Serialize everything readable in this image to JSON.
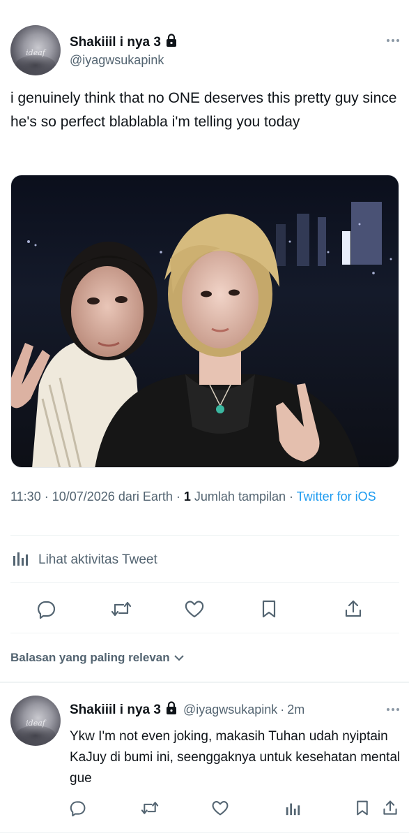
{
  "tweet": {
    "author": {
      "name": "Shakiiil i nya 3",
      "handle": "@iyagwsukapink",
      "avatar_text": "ideaf",
      "protected_icon": "lock-icon"
    },
    "text": "i genuinely think that no ONE deserves this pretty guy since he's so perfect blablabla i'm telling you today",
    "meta": {
      "time": "11:30",
      "date": "10/07/2026",
      "from_label": "dari",
      "location": "Earth",
      "view_count": "1",
      "view_label": "Jumlah tampilan",
      "client": "Twitter for iOS"
    },
    "activity_label": "Lihat aktivitas Tweet",
    "actions": [
      "reply-icon",
      "retweet-icon",
      "like-icon",
      "bookmark-icon",
      "share-icon"
    ]
  },
  "sort_label": "Balasan yang paling relevan",
  "reply": {
    "name": "Shakiiil i nya 3",
    "handle": "@iyagwsukapink",
    "separator": "·",
    "time": "2m",
    "avatar_text": "ideaf",
    "text": "Ykw I'm not even joking, makasih Tuhan udah nyiptain KaJuy di bumi ini, seenggaknya untuk kesehatan mental gue",
    "actions": [
      "reply-icon",
      "retweet-icon",
      "like-icon",
      "views-icon",
      "bookmark-icon",
      "share-icon"
    ]
  },
  "colors": {
    "link": "#1d9bf0",
    "secondary_text": "#536471",
    "primary_text": "#0f1419",
    "divider": "#eff3f4"
  }
}
